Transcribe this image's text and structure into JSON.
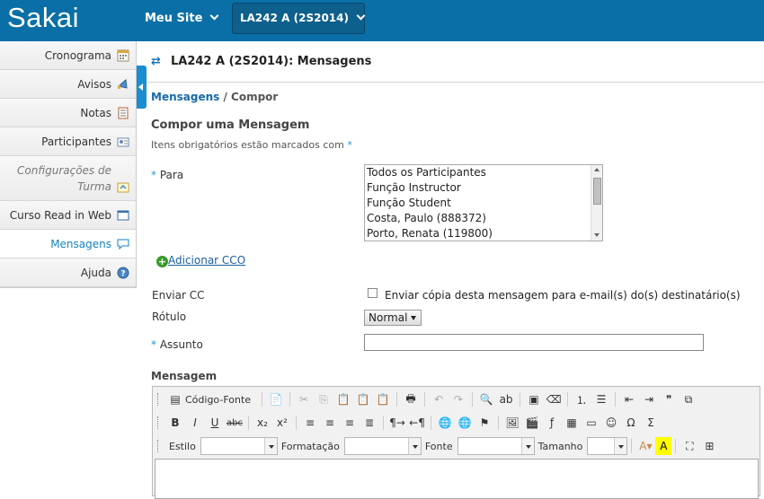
{
  "header": {
    "logo": "Sakai",
    "meu_site": "Meu Site",
    "site_button": "LA242 A (2S2014)",
    "bar_color": "#0a6fa6"
  },
  "sidebar": {
    "items": [
      {
        "label": "Cronograma",
        "icon": "calendar-icon"
      },
      {
        "label": "Avisos",
        "icon": "megaphone-icon"
      },
      {
        "label": "Notas",
        "icon": "notes-icon"
      },
      {
        "label": "Participantes",
        "icon": "participants-icon"
      },
      {
        "label": "Configurações de Turma",
        "icon": "settings-icon"
      },
      {
        "label": "Curso Read in Web",
        "icon": "web-icon"
      },
      {
        "label": "Mensagens",
        "icon": "speech-bubble-icon"
      },
      {
        "label": "Ajuda",
        "icon": "help-icon"
      }
    ],
    "label_configuracoes_1": "Configurações de",
    "label_configuracoes_2": "Turma",
    "active_color": "#1483c4"
  },
  "tool": {
    "title": "LA242 A (2S2014): Mensagens"
  },
  "breadcrumb": {
    "link": "Mensagens",
    "sep": " / ",
    "current": "Compor"
  },
  "form": {
    "title": "Compor uma Mensagem",
    "required_note": "Itens obrigatórios estão marcados com ",
    "required_mark": "*",
    "to_label": "Para",
    "to_options": [
      "Todos os Participantes",
      "Função Instructor",
      "Função Student",
      "Costa, Paulo (888372)",
      "Porto, Renata (119800)"
    ],
    "bcc_plus": "+",
    "bcc_link": "Adicionar CCO",
    "cc_label": "Enviar CC",
    "cc_text": "Enviar cópia desta mensagem para e-mail(s) do(s) destinatário(s)",
    "rotulo_label": "Rótulo",
    "rotulo_value": "Normal",
    "assunto_label": "Assunto",
    "mensagem_label": "Mensagem"
  },
  "editor": {
    "source_button": "Código-Fonte",
    "estilo_label": "Estilo",
    "formatacao_label": "Formatação",
    "fonte_label": "Fonte",
    "tamanho_label": "Tamanho"
  }
}
